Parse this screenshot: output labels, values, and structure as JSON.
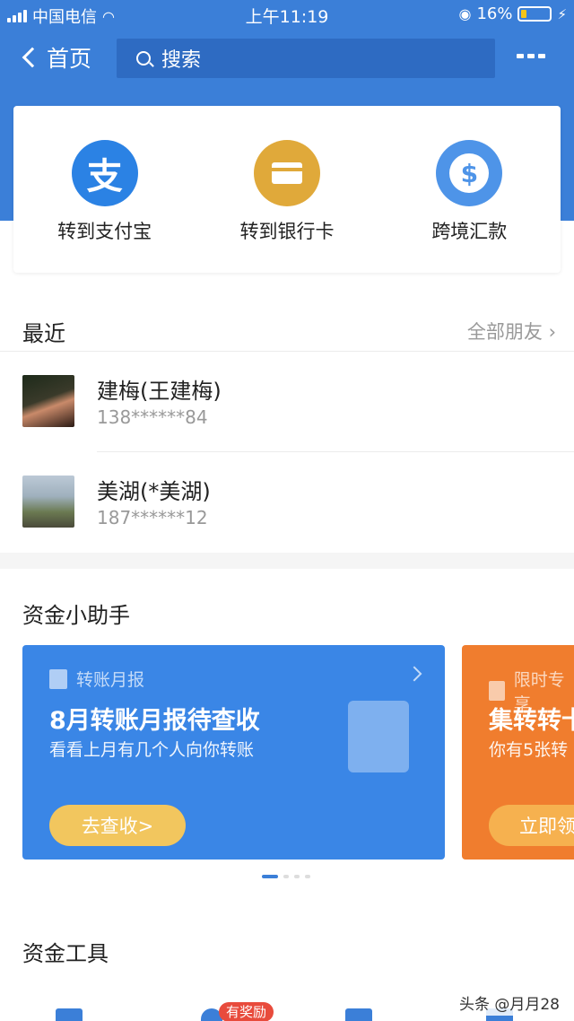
{
  "colors": {
    "brand_blue": "#3b7fd8",
    "alipay_blue": "#2b82e4",
    "bank_gold": "#e0a93a",
    "remit_blue": "#4e94e8",
    "promo_orange": "#f07d2e",
    "badge_red": "#e84b3c"
  },
  "status_bar": {
    "carrier": "中国电信",
    "time": "上午11:19",
    "battery": "16%"
  },
  "nav": {
    "back_label": "首页",
    "search_placeholder": "搜索",
    "more_icon": "more-icon"
  },
  "actions": [
    {
      "label": "转到支付宝",
      "icon": "alipay-icon",
      "glyph": "支"
    },
    {
      "label": "转到银行卡",
      "icon": "bank-card-icon"
    },
    {
      "label": "跨境汇款",
      "icon": "cross-border-remit-icon",
      "glyph": "$"
    }
  ],
  "recent": {
    "title": "最近",
    "all_friends": "全部朋友",
    "contacts": [
      {
        "name": "建梅(王建梅)",
        "phone": "138******84"
      },
      {
        "name": "美湖(*美湖)",
        "phone": "187******12"
      }
    ]
  },
  "assistant": {
    "title": "资金小助手",
    "cards": [
      {
        "tag": "转账月报",
        "headline": "8月转账月报待查收",
        "sub": "看看上月有几个人向你转账",
        "button": "去查收>"
      },
      {
        "tag": "限时专享",
        "headline": "集转转卡",
        "sub": "你有5张转",
        "button": "立即领取"
      }
    ],
    "page_count": 4,
    "active_page": 1
  },
  "tools": {
    "title": "资金工具",
    "badge": "有奖励"
  },
  "watermark": "头条 @月月28"
}
